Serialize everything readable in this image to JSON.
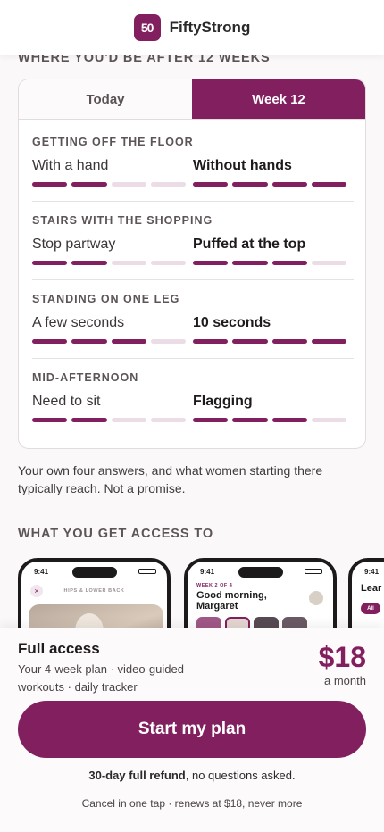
{
  "brand": {
    "logo_mark": "50",
    "name": "FiftyStrong"
  },
  "section1_title": "WHERE YOU'D BE AFTER 12 WEEKS",
  "tabs": {
    "today": "Today",
    "week": "Week 12"
  },
  "rows": [
    {
      "title": "GETTING OFF THE FLOOR",
      "today": "With a hand",
      "week": "Without hands",
      "today_level": 2,
      "week_level": 4
    },
    {
      "title": "STAIRS WITH THE SHOPPING",
      "today": "Stop partway",
      "week": "Puffed at the top",
      "today_level": 2,
      "week_level": 3
    },
    {
      "title": "STANDING ON ONE LEG",
      "today": "A few seconds",
      "week": "10 seconds",
      "today_level": 3,
      "week_level": 4
    },
    {
      "title": "MID-AFTERNOON",
      "today": "Need to sit",
      "week": "Flagging",
      "today_level": 2,
      "week_level": 3
    }
  ],
  "bar_count": 4,
  "note": "Your own four answers, and what women starting there typically reach. Not a promise.",
  "section2_title": "WHAT YOU GET ACCESS TO",
  "phones": {
    "time": "9:41",
    "p1_caption": "HIPS & LOWER BACK",
    "p1_close": "×",
    "p2_eyebrow": "WEEK 2 OF 4",
    "p2_greeting": "Good morning, Margaret",
    "p3_title": "Lear",
    "p3_chip": "All"
  },
  "plan": {
    "title": "Full access",
    "description": "Your 4-week plan · video-guided workouts · daily tracker",
    "price": "$18",
    "period": "a month"
  },
  "cta_label": "Start my plan",
  "refund_bold": "30-day full refund",
  "refund_rest": ", no questions asked.",
  "cancel_text": "Cancel in one tap · renews at $18, never more",
  "colors": {
    "accent": "#82205f",
    "bar_off": "#ecdce6"
  }
}
